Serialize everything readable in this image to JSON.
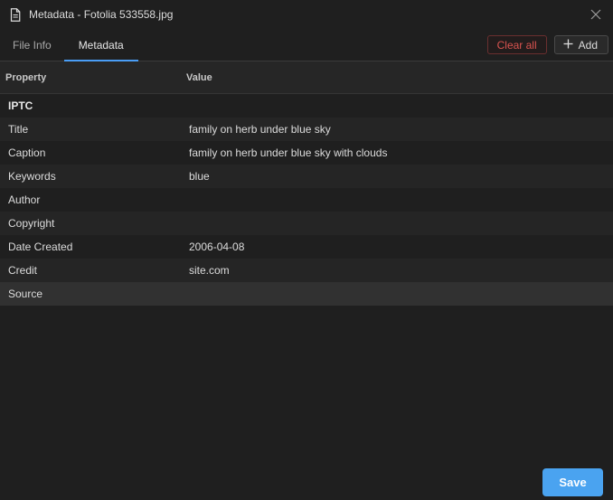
{
  "window": {
    "title": "Metadata - Fotolia 533558.jpg",
    "icon": "document-icon"
  },
  "tabs": [
    {
      "label": "File Info",
      "active": false
    },
    {
      "label": "Metadata",
      "active": true
    }
  ],
  "actions": {
    "clear_label": "Clear all",
    "add_label": "Add"
  },
  "table": {
    "headers": {
      "property": "Property",
      "value": "Value"
    },
    "section": "IPTC",
    "rows": [
      {
        "property": "Title",
        "value": "family on herb under blue sky"
      },
      {
        "property": "Caption",
        "value": "family on herb under blue sky with clouds"
      },
      {
        "property": "Keywords",
        "value": "blue"
      },
      {
        "property": "Author",
        "value": ""
      },
      {
        "property": "Copyright",
        "value": ""
      },
      {
        "property": "Date Created",
        "value": "2006-04-08"
      },
      {
        "property": "Credit",
        "value": "site.com"
      },
      {
        "property": "Source",
        "value": ""
      }
    ]
  },
  "footer": {
    "save_label": "Save"
  },
  "colors": {
    "accent": "#4aa3f0",
    "danger": "#d9534f",
    "background": "#1f1f1f"
  }
}
